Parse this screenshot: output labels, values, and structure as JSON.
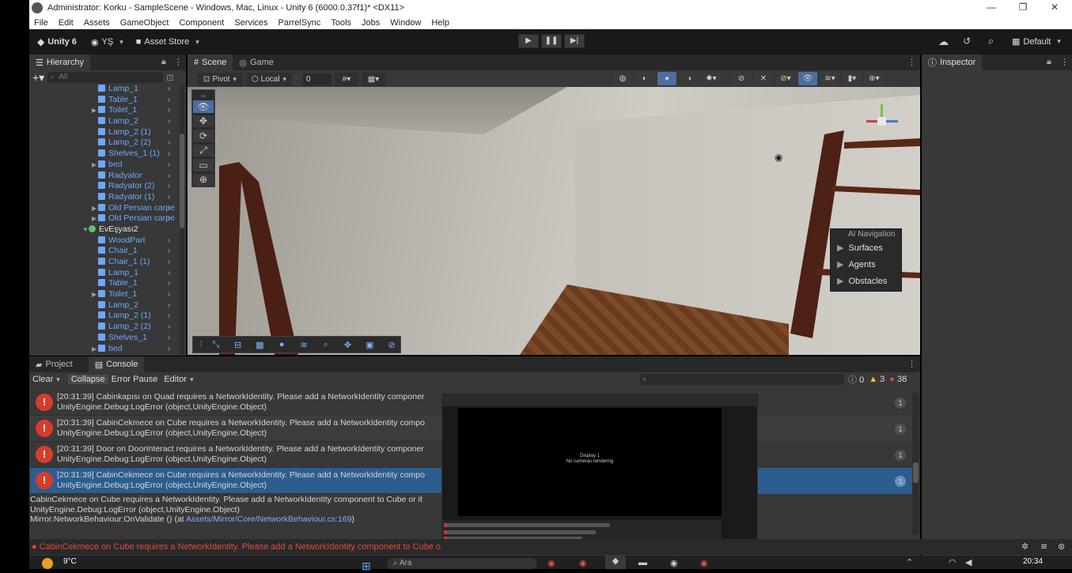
{
  "window": {
    "title": "Administrator: Korku - SampleScene - Windows, Mac, Linux - Unity 6 (6000.0.37f1)* <DX11>"
  },
  "menu": [
    "File",
    "Edit",
    "Assets",
    "GameObject",
    "Component",
    "Services",
    "ParrelSync",
    "Tools",
    "Jobs",
    "Window",
    "Help"
  ],
  "toolbar": {
    "unity": "Unity 6",
    "account": "YŞ",
    "asset_store": "Asset Store",
    "layout": "Default"
  },
  "hierarchy": {
    "tab": "Hierarchy",
    "search_placeholder": "All",
    "items": [
      {
        "label": "Lamp_1",
        "fold": false
      },
      {
        "label": "Table_1",
        "fold": false
      },
      {
        "label": "Toilet_1",
        "fold": true
      },
      {
        "label": "Lamp_2",
        "fold": false
      },
      {
        "label": "Lamp_2 (1)",
        "fold": false
      },
      {
        "label": "Lamp_2 (2)",
        "fold": false
      },
      {
        "label": "Shelves_1 (1)",
        "fold": false
      },
      {
        "label": "bed",
        "fold": true
      },
      {
        "label": "Radyator",
        "fold": false
      },
      {
        "label": "Radyator (2)",
        "fold": false
      },
      {
        "label": "Radyator (1)",
        "fold": false
      },
      {
        "label": "Old Persian carpe",
        "fold": true
      },
      {
        "label": "Old Persian carpe",
        "fold": true
      },
      {
        "label": "EvEşyası2",
        "fold": true,
        "parent": true
      },
      {
        "label": "WoodPart",
        "fold": false
      },
      {
        "label": "Chair_1",
        "fold": false
      },
      {
        "label": "Chair_1 (1)",
        "fold": false
      },
      {
        "label": "Lamp_1",
        "fold": false
      },
      {
        "label": "Table_1",
        "fold": false
      },
      {
        "label": "Toilet_1",
        "fold": true
      },
      {
        "label": "Lamp_2",
        "fold": false
      },
      {
        "label": "Lamp_2 (1)",
        "fold": false
      },
      {
        "label": "Lamp_2 (2)",
        "fold": false
      },
      {
        "label": "Shelves_1",
        "fold": false
      },
      {
        "label": "bed",
        "fold": true
      }
    ]
  },
  "scene": {
    "tabs": [
      "Scene",
      "Game"
    ],
    "pivot": "Pivot",
    "local": "Local",
    "snap_value": "0",
    "ai_nav": {
      "title": "AI Navigation",
      "items": [
        "Surfaces",
        "Agents",
        "Obstacles"
      ]
    }
  },
  "inspector": {
    "tab": "Inspector"
  },
  "console": {
    "tabs": [
      "Project",
      "Console"
    ],
    "clear": "Clear",
    "collapse": "Collapse",
    "error_pause": "Error Pause",
    "editor": "Editor",
    "counts": {
      "info": "0",
      "warn": "3",
      "error": "38"
    },
    "logs": [
      {
        "l1": "[20:31:39] Cabinkapısı on Quad requires a NetworkIdentity. Please add a NetworkIdentity componer",
        "l2": "UnityEngine.Debug:LogError (object,UnityEngine.Object)",
        "count": "1"
      },
      {
        "l1": "[20:31:39] CabinCekmece on Cube requires a NetworkIdentity. Please add a NetworkIdentity compo",
        "l2": "UnityEngine.Debug:LogError (object,UnityEngine.Object)",
        "count": "1"
      },
      {
        "l1": "[20:31:39] Door on DoorInteract requires a NetworkIdentity. Please add a NetworkIdentity componer",
        "l2": "UnityEngine.Debug:LogError (object,UnityEngine.Object)",
        "count": "1"
      },
      {
        "l1": "[20:31:39] CabinCekmece on Cube requires a NetworkIdentity. Please add a NetworkIdentity compo",
        "l2": "UnityEngine.Debug:LogError (object,UnityEngine.Object)",
        "count": "1"
      }
    ],
    "detail": [
      "CabinCekmece on Cube requires a NetworkIdentity. Please add a NetworkIdentity component to Cube or it",
      "UnityEngine.Debug:LogError (object,UnityEngine.Object)",
      "Mirror.NetworkBehaviour:OnValidate () (at "
    ],
    "detail_link": "Assets/Mirror/Core/NetworkBehaviour.cs:169",
    "detail_tail": ")",
    "status": "CabinCekmece on Cube requires a NetworkIdentity. Please add a NetworkIdentity component to Cube o"
  },
  "overlay": {
    "display": "Display 1",
    "msg": "No cameras rendering"
  },
  "taskbar": {
    "weather": "9°C",
    "search": "Ara",
    "clock": "20:34"
  }
}
